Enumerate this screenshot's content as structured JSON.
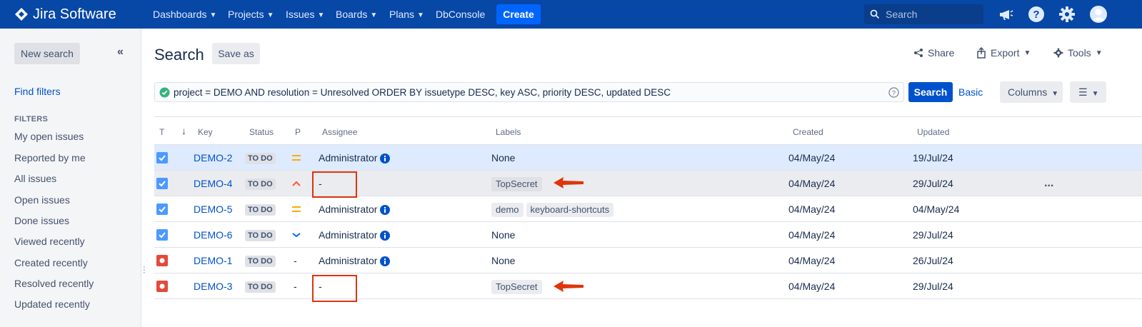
{
  "nav": {
    "logo_text": "Jira Software",
    "items": [
      {
        "label": "Dashboards",
        "dropdown": true
      },
      {
        "label": "Projects",
        "dropdown": true
      },
      {
        "label": "Issues",
        "dropdown": true
      },
      {
        "label": "Boards",
        "dropdown": true
      },
      {
        "label": "Plans",
        "dropdown": true
      },
      {
        "label": "DbConsole",
        "dropdown": false
      }
    ],
    "create_label": "Create",
    "search_placeholder": "Search",
    "icons": [
      "notifications-megaphone-icon",
      "help-icon",
      "settings-gear-icon",
      "user-avatar-icon"
    ],
    "colors": {
      "bar": "#0747a6",
      "create": "#0065ff"
    }
  },
  "sidebar": {
    "new_search_label": "New search",
    "collapse_glyph": "«",
    "find_filters_label": "Find filters",
    "filters_heading": "FILTERS",
    "filters": [
      "My open issues",
      "Reported by me",
      "All issues",
      "Open issues",
      "Done issues",
      "Viewed recently",
      "Created recently",
      "Resolved recently",
      "Updated recently"
    ]
  },
  "header": {
    "title": "Search",
    "save_as_label": "Save as",
    "share_label": "Share",
    "export_label": "Export",
    "tools_label": "Tools"
  },
  "jql": {
    "query": "project = DEMO AND resolution = Unresolved ORDER BY issuetype DESC, key ASC, priority DESC, updated DESC",
    "valid": true,
    "search_label": "Search",
    "basic_label": "Basic",
    "columns_label": "Columns"
  },
  "table": {
    "columns": {
      "type": "T",
      "key": "Key",
      "status": "Status",
      "priority": "P",
      "assignee": "Assignee",
      "labels": "Labels",
      "created": "Created",
      "updated": "Updated"
    },
    "sort_indicator": "↓",
    "rows": [
      {
        "type": "task",
        "key": "DEMO-2",
        "status": "TO DO",
        "priority": "medium",
        "assignee": "Administrator",
        "labels": [],
        "labels_empty": "None",
        "created": "04/May/24",
        "updated": "19/Jul/24",
        "state": "selected"
      },
      {
        "type": "task",
        "key": "DEMO-4",
        "status": "TO DO",
        "priority": "high",
        "assignee": "-",
        "labels": [
          "TopSecret"
        ],
        "labels_empty": "",
        "created": "04/May/24",
        "updated": "29/Jul/24",
        "state": "hover",
        "actions": "..."
      },
      {
        "type": "task",
        "key": "DEMO-5",
        "status": "TO DO",
        "priority": "medium",
        "assignee": "Administrator",
        "labels": [
          "demo",
          "keyboard-shortcuts"
        ],
        "labels_empty": "",
        "created": "04/May/24",
        "updated": "04/May/24",
        "state": "normal"
      },
      {
        "type": "task",
        "key": "DEMO-6",
        "status": "TO DO",
        "priority": "low",
        "assignee": "Administrator",
        "labels": [],
        "labels_empty": "None",
        "created": "04/May/24",
        "updated": "29/Jul/24",
        "state": "normal"
      },
      {
        "type": "bug",
        "key": "DEMO-1",
        "status": "TO DO",
        "priority": "-",
        "assignee": "Administrator",
        "labels": [],
        "labels_empty": "None",
        "created": "04/May/24",
        "updated": "26/Jul/24",
        "state": "normal"
      },
      {
        "type": "bug",
        "key": "DEMO-3",
        "status": "TO DO",
        "priority": "-",
        "assignee": "-",
        "labels": [
          "TopSecret"
        ],
        "labels_empty": "",
        "created": "04/May/24",
        "updated": "29/Jul/24",
        "state": "normal"
      }
    ],
    "colors": {
      "task": "#4c9aff",
      "bug": "#e5493a",
      "medium": "#ffab00",
      "high": "#ff5630",
      "low": "#0065ff",
      "annotation": "#de350b"
    }
  }
}
